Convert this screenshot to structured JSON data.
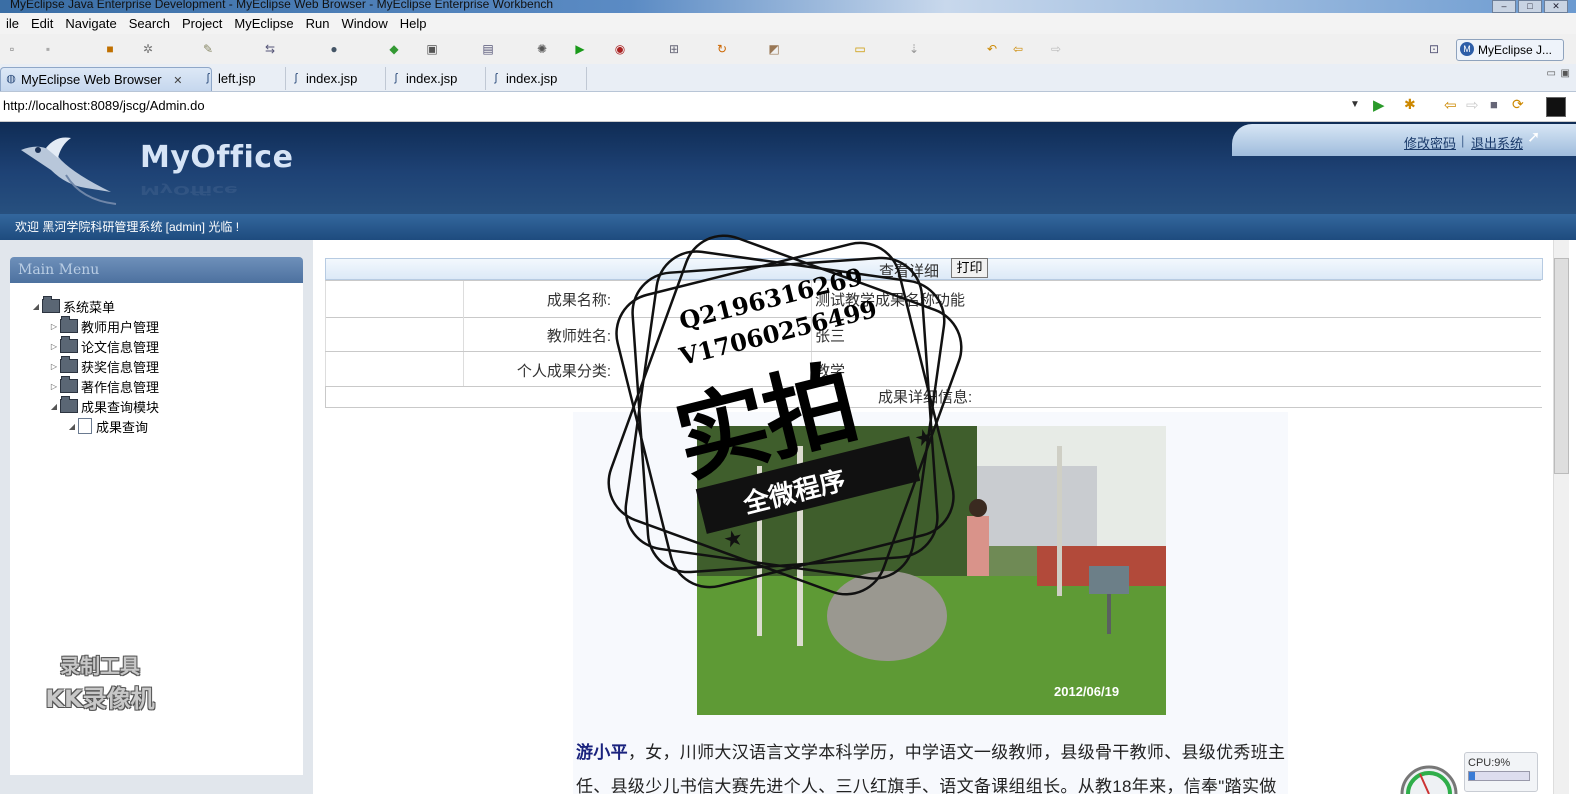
{
  "window": {
    "title": "MyEclipse Java Enterprise Development - MyEclipse Web Browser - MyEclipse Enterprise Workbench"
  },
  "menubar": [
    "ile",
    "Edit",
    "Navigate",
    "Search",
    "Project",
    "MyEclipse",
    "Run",
    "Window",
    "Help"
  ],
  "perspective": {
    "label": "MyEclipse J..."
  },
  "editor_tabs": [
    {
      "label": "MyEclipse Web Browser",
      "active": true
    },
    {
      "label": "left.jsp"
    },
    {
      "label": "index.jsp"
    },
    {
      "label": "index.jsp"
    },
    {
      "label": "index.jsp"
    }
  ],
  "browser": {
    "url": "http://localhost:8089/jscg/Admin.do"
  },
  "app": {
    "brand": "MyOffice",
    "links": {
      "change_password": "修改密码",
      "separator": "|",
      "logout": "退出系统"
    },
    "welcome": "欢迎 黑河学院科研管理系统 [admin] 光临 !"
  },
  "menu": {
    "title": "Main Menu",
    "root": "系统菜单",
    "items": [
      "教师用户管理",
      "论文信息管理",
      "获奖信息管理",
      "著作信息管理",
      "成果查询模块"
    ],
    "subitem": "成果查询"
  },
  "detail": {
    "title": "查看详细",
    "print_label": "打印",
    "fields": [
      {
        "label": "成果名称:",
        "value": "测试教学成果名称功能"
      },
      {
        "label": "教师姓名:",
        "value": "张三"
      },
      {
        "label": "个人成果分类:",
        "value": "教学"
      }
    ],
    "info_label": "成果详细信息:",
    "photo_date": "2012/06/19",
    "bio_name": "游小平",
    "bio_line1": "，女，川师大汉语言文学本科学历，中学语文一级教师，县级骨干教师、县级优秀班主",
    "bio_line2": "任、县级少儿书信大赛先进个人、三八红旗手、语文备课组组长。从教18年来，信奉\"踏实做"
  },
  "watermarks": {
    "stamp_qq": "Q2196316269",
    "stamp_wx": "V17060256499",
    "stamp_big": "实拍",
    "stamp_ribbon": "全微程序",
    "recorder_line1": "录制工具",
    "recorder_line2": "KK录像机"
  },
  "status": {
    "cpu": "CPU:9%",
    "cpu_fraction": 0.09
  },
  "colors": {
    "header": "#1e4275",
    "link": "#1a3a6a",
    "accent": "#3a7bd5"
  }
}
